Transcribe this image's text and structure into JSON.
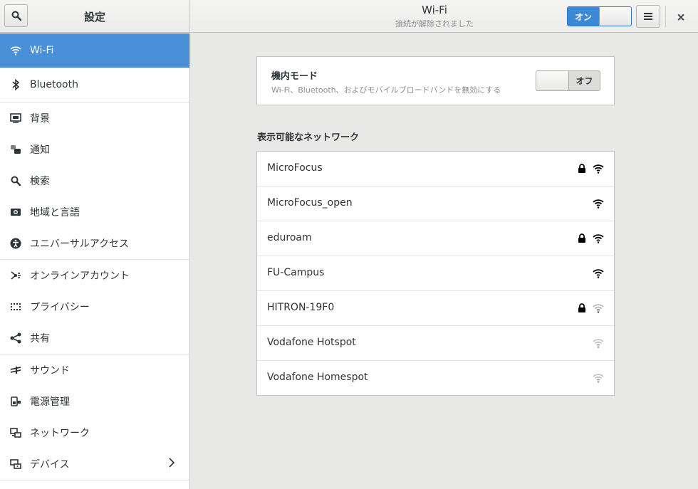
{
  "header": {
    "left_title": "設定",
    "title": "Wi-Fi",
    "subtitle": "接続が解除されました",
    "wifi_switch_label": "オン",
    "wifi_switch_state": "on",
    "close_label": "×"
  },
  "sidebar": {
    "items": [
      {
        "label": "Wi-Fi",
        "icon": "wifi-icon",
        "active": true
      },
      {
        "label": "Bluetooth",
        "icon": "bluetooth-icon"
      },
      {
        "label": "背景",
        "icon": "background-icon"
      },
      {
        "label": "通知",
        "icon": "notifications-icon"
      },
      {
        "label": "検索",
        "icon": "search-icon"
      },
      {
        "label": "地域と言語",
        "icon": "region-language-icon"
      },
      {
        "label": "ユニバーサルアクセス",
        "icon": "universal-access-icon"
      },
      {
        "label": "オンラインアカウント",
        "icon": "online-accounts-icon"
      },
      {
        "label": "プライバシー",
        "icon": "privacy-icon"
      },
      {
        "label": "共有",
        "icon": "share-icon"
      },
      {
        "label": "サウンド",
        "icon": "sound-icon"
      },
      {
        "label": "電源管理",
        "icon": "power-icon"
      },
      {
        "label": "ネットワーク",
        "icon": "network-icon"
      },
      {
        "label": "デバイス",
        "icon": "devices-icon"
      }
    ]
  },
  "airplane": {
    "title": "機内モード",
    "description": "Wi-Fi、Bluetooth、およびモバイルブロードバンドを無効にする",
    "switch_label": "オフ",
    "switch_state": "off"
  },
  "networks": {
    "heading": "表示可能なネットワーク",
    "list": [
      {
        "name": "MicroFocus",
        "secured": true,
        "signal": "strong"
      },
      {
        "name": "MicroFocus_open",
        "secured": false,
        "signal": "strong"
      },
      {
        "name": "eduroam",
        "secured": true,
        "signal": "strong"
      },
      {
        "name": "FU-Campus",
        "secured": false,
        "signal": "strong"
      },
      {
        "name": "HITRON-19F0",
        "secured": true,
        "signal": "weak"
      },
      {
        "name": "Vodafone Hotspot",
        "secured": false,
        "signal": "weak"
      },
      {
        "name": "Vodafone Homespot",
        "secured": false,
        "signal": "weak"
      }
    ]
  },
  "colors": {
    "accent": "#4a90d9",
    "switch_on": "#3d88d6"
  }
}
